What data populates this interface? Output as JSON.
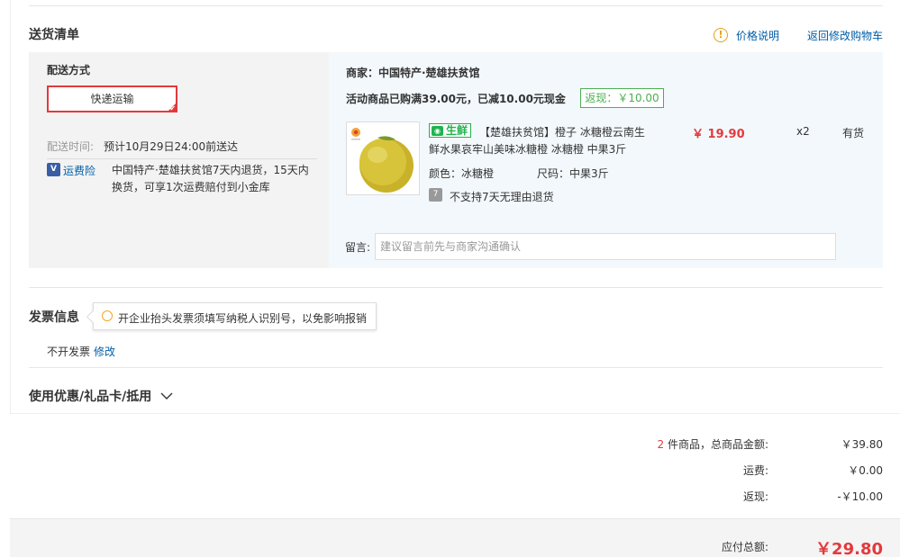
{
  "delivery": {
    "title": "送货清单",
    "price_info_link": "价格说明",
    "back_to_cart_link": "返回修改购物车",
    "method_label": "配送方式",
    "method_selected": "快递运输",
    "time_label": "配送时间:",
    "time_value": "预计10月29日24:00前送达",
    "insurance_label": "运费险",
    "insurance_desc_1": "中国特产·楚雄扶贫馆7天内退货，15天内",
    "insurance_desc_2": "换货，可享1次运费赔付到小金库"
  },
  "merchant": {
    "name": "商家：中国特产·楚雄扶贫馆",
    "promo_text": "活动商品已购满39.00元，已减10.00元现金",
    "rebate_badge": "返现：￥10.00"
  },
  "product": {
    "fresh_tag": "生鲜",
    "title_line_1": "【楚雄扶贫馆】橙子 冰糖橙云南生",
    "title_line_2": "鲜水果哀牢山美味冰糖橙 冰糖橙 中果3斤",
    "color_label": "颜色：",
    "color_value": "冰糖橙",
    "size_label": "尺码：",
    "size_value": "中果3斤",
    "return_policy": "不支持7天无理由退货",
    "price": "￥ 19.90",
    "quantity": "x2",
    "stock": "有货"
  },
  "message": {
    "label": "留言:",
    "placeholder": "建议留言前先与商家沟通确认"
  },
  "invoice": {
    "title": "发票信息",
    "tip": "开企业抬头发票须填写纳税人识别号，以免影响报销",
    "status": "不开发票",
    "edit_link": "修改"
  },
  "coupon": {
    "title": "使用优惠/礼品卡/抵用"
  },
  "summary": {
    "item_count": "2",
    "items_total_label": "件商品，总商品金额:",
    "items_total": "￥39.80",
    "shipping_label": "运费:",
    "shipping": "￥0.00",
    "rebate_label": "返现:",
    "rebate": "-￥10.00",
    "payable_label": "应付总额:",
    "payable": "￥29.80"
  },
  "colors": {
    "accent_red": "#e4393c",
    "link_blue": "#005ea7",
    "fresh_green": "#20b24f"
  }
}
